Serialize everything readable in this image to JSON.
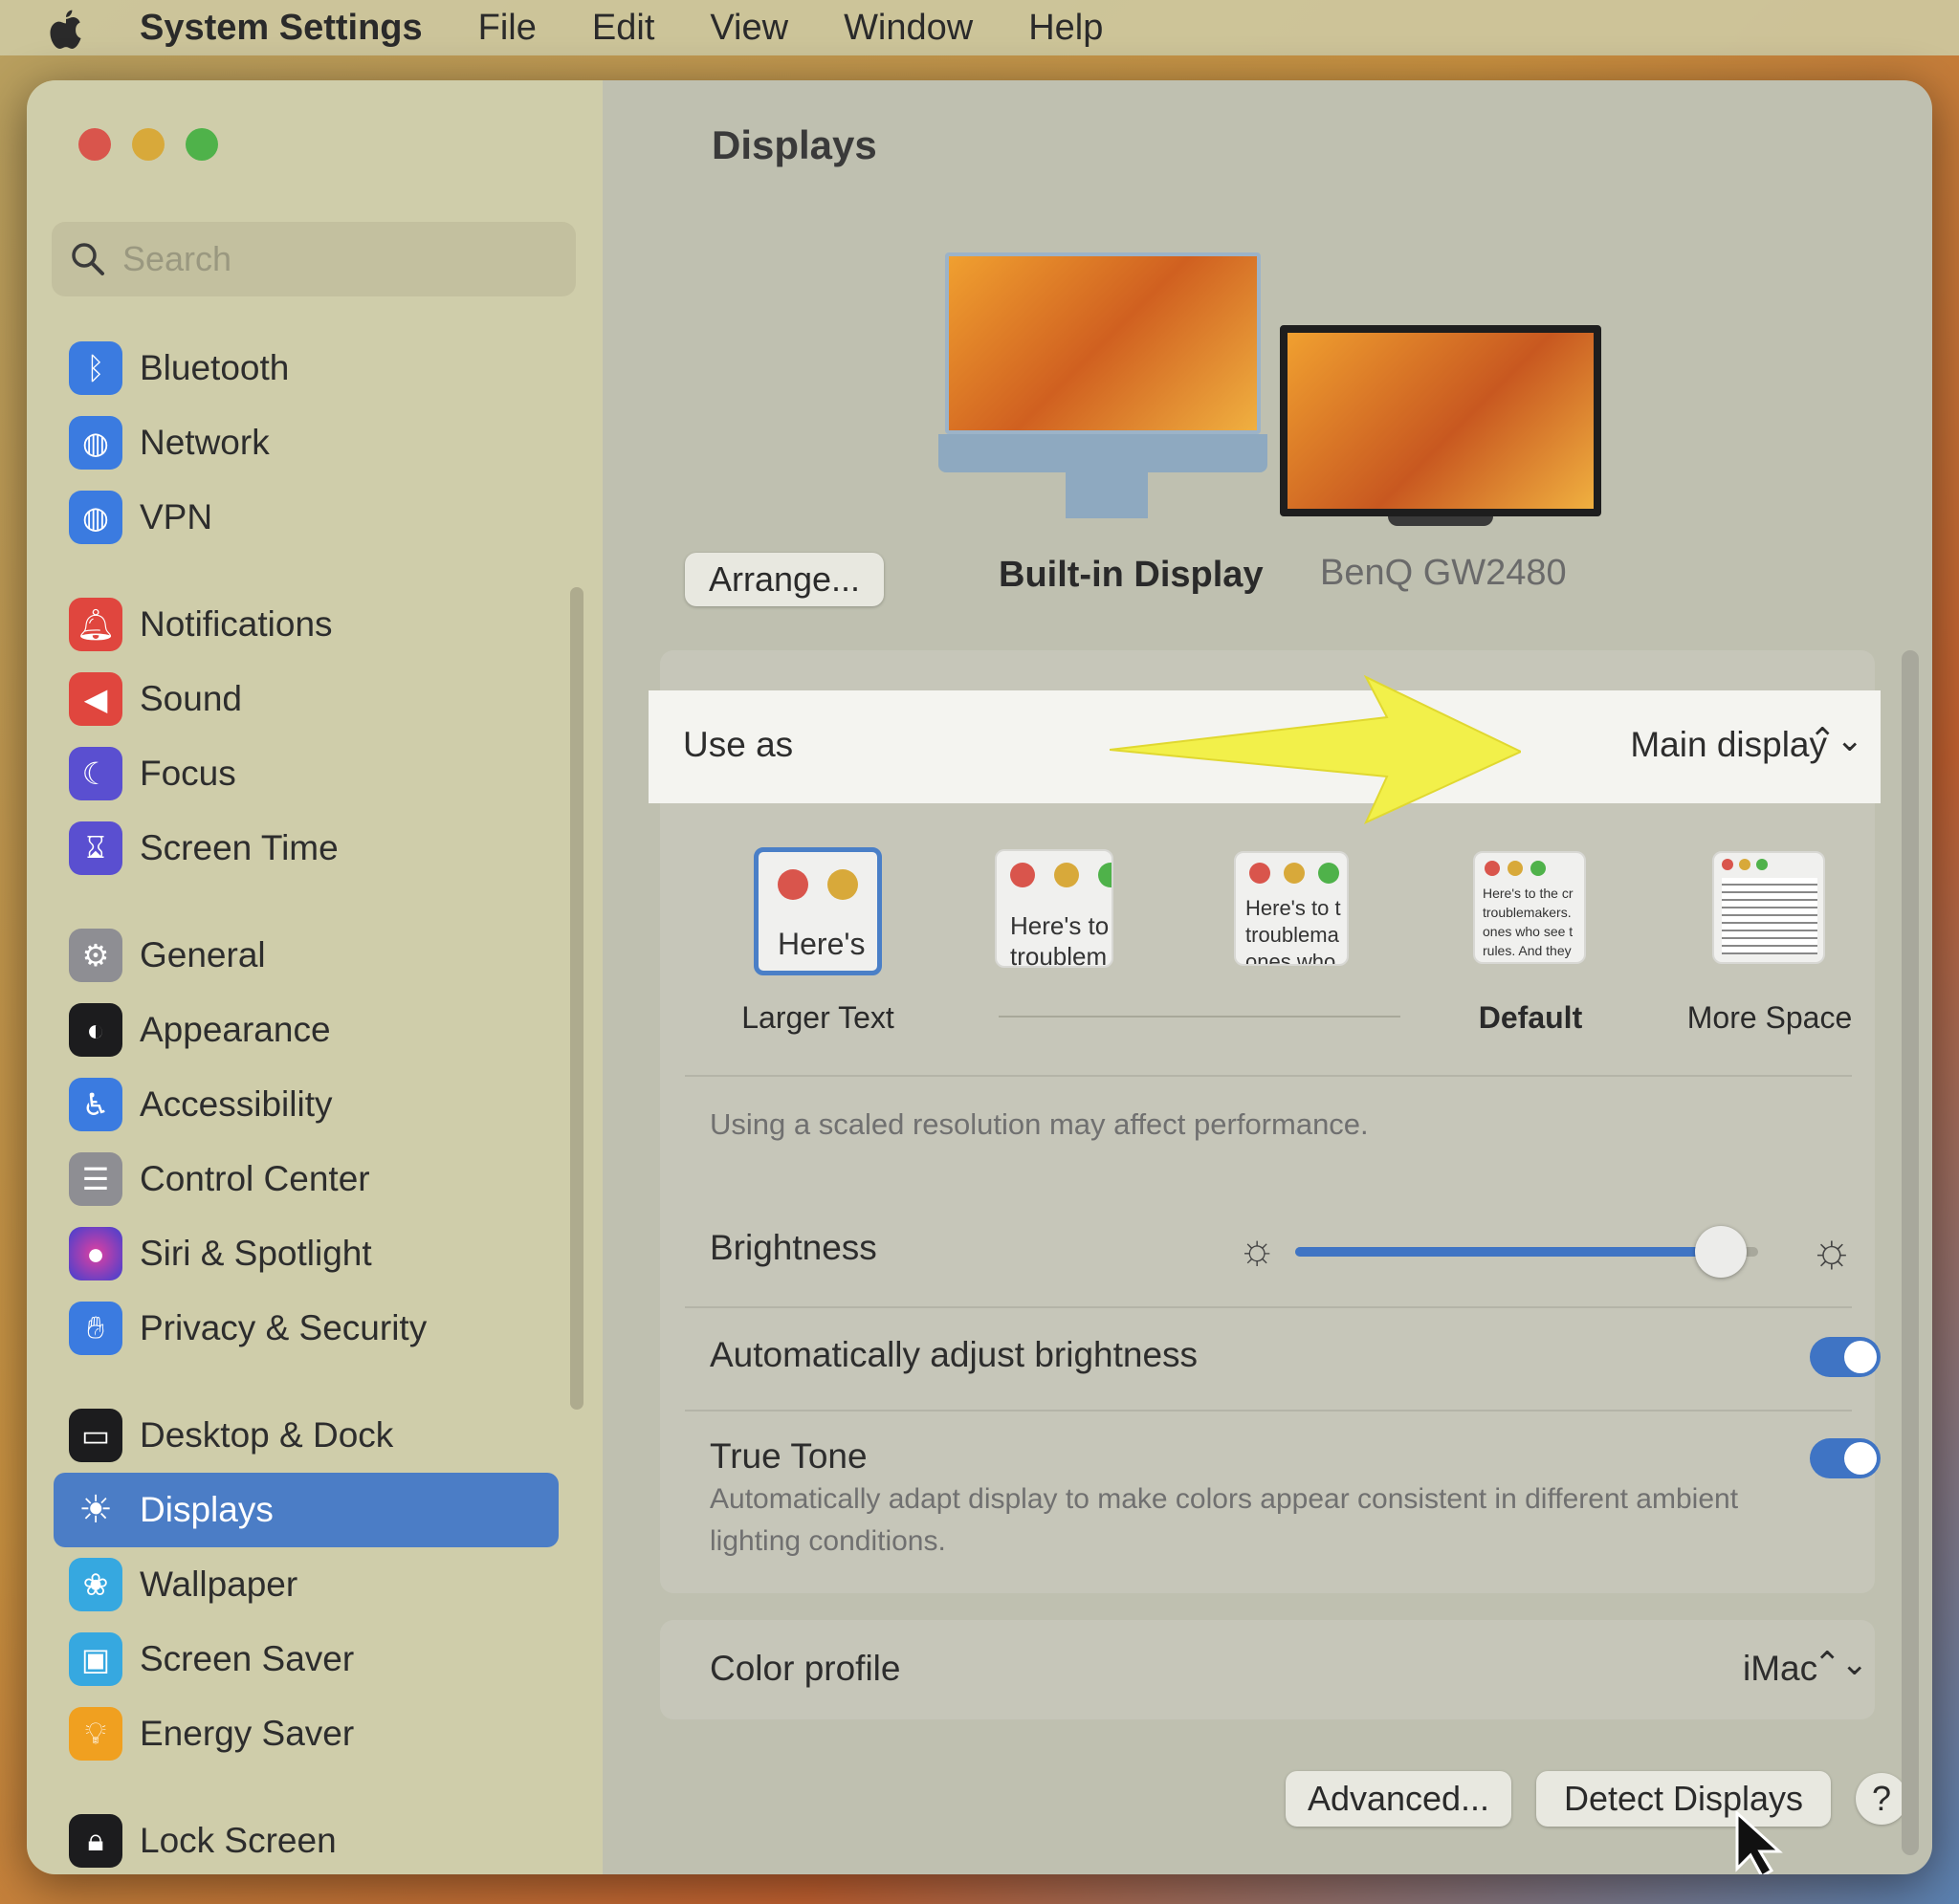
{
  "menubar": {
    "app_name": "System Settings",
    "items": [
      "File",
      "Edit",
      "View",
      "Window",
      "Help"
    ]
  },
  "sidebar": {
    "search_placeholder": "Search",
    "items": [
      {
        "label": "Bluetooth",
        "icon": "bluetooth-icon",
        "color": "#3b7be0"
      },
      {
        "label": "Network",
        "icon": "globe-icon",
        "color": "#3b7be0"
      },
      {
        "label": "VPN",
        "icon": "vpn-globe-icon",
        "color": "#3b7be0"
      },
      {
        "label": "Notifications",
        "icon": "bell-icon",
        "color": "#e0463e"
      },
      {
        "label": "Sound",
        "icon": "speaker-icon",
        "color": "#e0463e"
      },
      {
        "label": "Focus",
        "icon": "moon-icon",
        "color": "#5a4fd0"
      },
      {
        "label": "Screen Time",
        "icon": "hourglass-icon",
        "color": "#5a4fd0"
      },
      {
        "label": "General",
        "icon": "gear-icon",
        "color": "#8e8e93"
      },
      {
        "label": "Appearance",
        "icon": "appearance-icon",
        "color": "#1c1c1e"
      },
      {
        "label": "Accessibility",
        "icon": "accessibility-icon",
        "color": "#3b7be0"
      },
      {
        "label": "Control Center",
        "icon": "control-center-icon",
        "color": "#8e8e93"
      },
      {
        "label": "Siri & Spotlight",
        "icon": "siri-icon",
        "color": "#8c3cc8"
      },
      {
        "label": "Privacy & Security",
        "icon": "hand-icon",
        "color": "#3b7be0"
      },
      {
        "label": "Desktop & Dock",
        "icon": "dock-icon",
        "color": "#1c1c1e"
      },
      {
        "label": "Displays",
        "icon": "sun-icon",
        "color": "#3b7be0"
      },
      {
        "label": "Wallpaper",
        "icon": "flower-icon",
        "color": "#36a8e0"
      },
      {
        "label": "Screen Saver",
        "icon": "screensaver-icon",
        "color": "#36a8e0"
      },
      {
        "label": "Energy Saver",
        "icon": "bulb-icon",
        "color": "#f0a020"
      },
      {
        "label": "Lock Screen",
        "icon": "lock-icon",
        "color": "#1c1c1e"
      }
    ],
    "selected": "Displays"
  },
  "main": {
    "title": "Displays",
    "arrange_button": "Arrange...",
    "displays": [
      "Built-in Display",
      "BenQ GW2480"
    ],
    "selected_display": "Built-in Display",
    "use_as": {
      "label": "Use as",
      "value": "Main display"
    },
    "resolutions": [
      "Larger Text",
      "Default",
      "More Space"
    ],
    "thumb_texts": [
      "Here's",
      "Here's to troublem",
      "Here's to t troublema ones who",
      "Here's to the cr troublemakers. ones who see t rules. And they"
    ],
    "resolution_note": "Using a scaled resolution may affect performance.",
    "brightness": {
      "label": "Brightness",
      "value": 0.92
    },
    "auto_brightness": {
      "label": "Automatically adjust brightness",
      "on": true
    },
    "true_tone": {
      "label": "True Tone",
      "description": "Automatically adapt display to make colors appear consistent in different ambient lighting conditions.",
      "on": true
    },
    "color_profile": {
      "label": "Color profile",
      "value": "iMac"
    },
    "buttons": {
      "advanced": "Advanced...",
      "detect": "Detect Displays",
      "help": "?"
    }
  },
  "colors": {
    "accent": "#4b7dc6",
    "annotation_arrow": "#f2f04a"
  }
}
